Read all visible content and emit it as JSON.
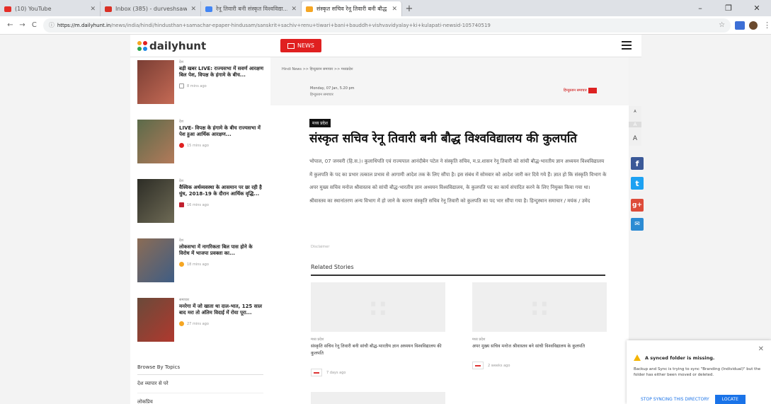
{
  "browser": {
    "tabs": [
      {
        "title": "(10) YouTube",
        "favicon": "youtube-icon",
        "color": "#e52d27",
        "active": false
      },
      {
        "title": "Inbox (385) - durveshsawarkar@g...",
        "favicon": "gmail-icon",
        "color": "#d93025",
        "active": false
      },
      {
        "title": "रेनू तिवारी बनी संस्कृत विश्वविद्या...",
        "favicon": "google-icon",
        "color": "#4285f4",
        "active": false
      },
      {
        "title": "संस्कृत सचिव रेनू तिवारी बनी बौद्ध वि...",
        "favicon": "dailyhunt-icon",
        "color": "#f5a623",
        "active": true
      }
    ],
    "new_tab": "+",
    "window_controls": [
      "–",
      "❐",
      "✕"
    ],
    "url_host": "https://m.dailyhunt.in",
    "url_path": "/news/india/hindi/hindusthan+samachar-epaper-hindusam/sanskrit+sachiv+renu+tiwari+bani+bauddh+vishvavidyalay+ki+kulapati-newsid-105740519"
  },
  "site": {
    "logo": "dailyhunt",
    "news_button": "NEWS"
  },
  "sidebar": {
    "stories": [
      {
        "category": "देश",
        "headline": "बड़ी खबर LIVE: राज्यसभा में सवर्ण आरक्षण बिल पेश, विपक्ष के हंगामे के बीच...",
        "time": "8 mins ago",
        "thumb": "#7a3e34"
      },
      {
        "category": "देश",
        "headline": "LIVE- विपक्ष के हंगामे के बीच राज्यसभा में पेश हुआ आर्थिक आरक्षण...",
        "time": "15 mins ago",
        "thumb": "#5b6b4a"
      },
      {
        "category": "देश",
        "headline": "वैश्विक अर्थव्यवस्था के आसमान पर छा रही है धुंध, 2018-19 के दौरान आर्थिक वृद्धि...",
        "time": "16 mins ago",
        "thumb": "#3a3a30"
      },
      {
        "category": "देश",
        "headline": "लोकसभा में नागरिकता बिल पास होने के विरोध में भाजपा प्रवक्ता का...",
        "time": "18 mins ago",
        "thumb": "#8b6c55"
      },
      {
        "category": "समाचार",
        "headline": "मनरेगा में जो खाता था दाल-भात, 125 साल बाद मरा तो अंतिम विदाई में रोया पूरा...",
        "time": "27 mins ago",
        "thumb": "#6a4a3a"
      }
    ],
    "browse_title": "Browse By Topics",
    "browse_items": [
      "देश व्यापार से परे",
      "लोकप्रिय"
    ]
  },
  "article": {
    "breadcrumb": "Hindi News >> हिन्दुस्तान समाचार >> मध्यप्रदेश",
    "date": "Monday, 07 Jan, 5.20 pm",
    "source": "हिन्दुस्तान समाचार",
    "publisher": "हिन्दुस्तान समाचार",
    "tag": "मध्य प्रदेश",
    "title": "संस्कृत सचिव रेनू तिवारी बनी बौद्ध विश्वविद्यालय की कुलपति",
    "body": "भोपाल, 07 जनवरी (हि.स.)। कुलाधिपति एवं राज्यपाल आनंदीबेन पटेल ने संस्कृति सचिव, म.प्र.शासन रेनू तिवारी को सांची बौद्ध-भारतीय ज्ञान अध्ययन विश्वविद्यालय में कुलपति के पद का प्रभार तत्काल प्रभाव से आगामी आदेश तक के लिए सौंपा है। इस संबंध में सोमवार को आदेश जारी कर दिये गये हैं। ज्ञात हो कि संस्कृति विभाग के अपर मुख्य सचिव मनोज श्रीवास्तव को सांची बौद्ध-भारतीय ज्ञान अध्ययन विश्वविद्यालय, के कुलपति पद का कार्य संपादित करने के लिए नियुक्त किया गया था। श्रीवास्तव का स्थानांतरण अन्य विभाग में हो जाने के कारण संस्कृति सचिव रेनू तिवारी को कुलपति का पद भार सौंपा गया है। हिन्दुस्थान समाचार / मयंक / उमेद",
    "disclaimer": "Disclaimer",
    "related_heading": "Related Stories",
    "related": [
      {
        "category": "मध्य प्रदेश",
        "title": "संस्कृति सचिव रेनू तिवारी बनी सांची बौद्ध-भारतीय ज्ञान अध्ययन विश्वविद्यालय की कुलपति",
        "time": "7 days ago"
      },
      {
        "category": "मध्य प्रदेश",
        "title": "अपर मुख्य सचिव मनोज श्रीवास्तव बने सांची विश्वविद्यालय के कुलपति",
        "time": "2 weeks ago"
      }
    ]
  },
  "font_controls": [
    "A",
    "A",
    "A"
  ],
  "social": [
    {
      "name": "facebook",
      "glyph": "f",
      "color": "#3b5998"
    },
    {
      "name": "twitter",
      "glyph": "t",
      "color": "#1da1f2"
    },
    {
      "name": "google-plus",
      "glyph": "g+",
      "color": "#dd4b39"
    },
    {
      "name": "email",
      "glyph": "✉",
      "color": "#2c8bd3"
    }
  ],
  "toast": {
    "title": "A synced folder is missing.",
    "body": "Backup and Sync is trying to sync \"Branding (Individual)\" but the folder has either been moved or deleted.",
    "stop": "STOP SYNCING THIS DIRECTORY",
    "locate": "LOCATE",
    "close": "✕"
  }
}
